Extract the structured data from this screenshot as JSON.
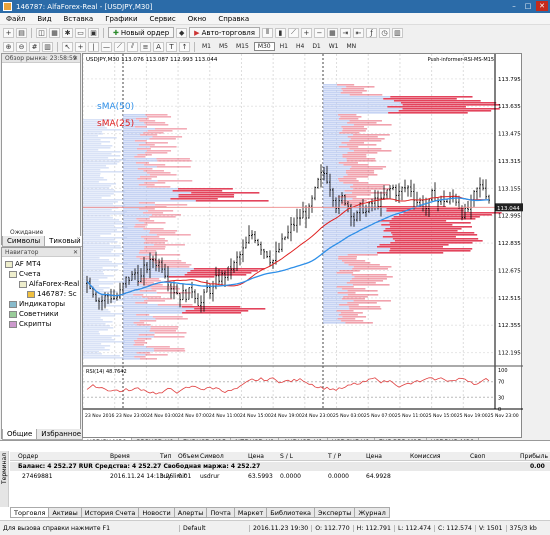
{
  "window": {
    "title": "146787: AlfaForex-Real - [USDJPY,M30]"
  },
  "menu": [
    "Файл",
    "Вид",
    "Вставка",
    "Графики",
    "Сервис",
    "Окно",
    "Справка"
  ],
  "toolbar": {
    "new_order": "Новый ордер",
    "auto_trading": "Авто-торговля",
    "timeframes": [
      "M1",
      "M5",
      "M15",
      "M30",
      "H1",
      "H4",
      "D1",
      "W1",
      "MN"
    ]
  },
  "market_watch": {
    "title": "Обзор рынка: 23:58:59",
    "status": "Ожидание обновления",
    "tabs": [
      "Символы",
      "Тиковый гр"
    ]
  },
  "navigator": {
    "title": "Навигатор",
    "items": [
      "AF MT4",
      "Счета",
      "AlfaForex-Real",
      "146787: Sc",
      "Индикаторы",
      "Советники",
      "Скрипты"
    ],
    "tabs": [
      "Общие",
      "Избранное"
    ]
  },
  "chart": {
    "header": "USDJPY,M30  113.076 113.087 112.993 113.044",
    "indicator_name": "Push-informer-RSI-MS-M15",
    "sma50": "sMA(50)",
    "sma25": "sMA(25)",
    "rsi_label": "RSI(14) 48.7642",
    "price_ticks": [
      "113.795",
      "113.635",
      "113.475",
      "113.315",
      "113.155",
      "112.995",
      "112.835",
      "112.675",
      "112.515",
      "112.355",
      "112.195"
    ],
    "price_hi": 113.87,
    "price_lo": 112.14,
    "current_price": "113.044",
    "rsi_ticks": [
      "100",
      "70",
      "30",
      "0"
    ],
    "time_ticks": [
      "23 Nov 2016",
      "23 Nov 23:00",
      "24 Nov 03:00",
      "24 Nov 07:00",
      "24 Nov 11:00",
      "24 Nov 15:00",
      "24 Nov 19:00",
      "24 Nov 23:00",
      "25 Nov 03:00",
      "25 Nov 07:00",
      "25 Nov 11:00",
      "25 Nov 15:00",
      "25 Nov 19:00",
      "25 Nov 23:00"
    ],
    "colors": {
      "sma50": "#2e8fe8",
      "sma25": "#e02020",
      "volume": "#e0304a",
      "profile": "#b8c8f0"
    }
  },
  "symbol_tabs": [
    "USDJPY,M30",
    "GBPUSD,H1",
    "EURUSD,M15",
    "NZDUSD,H1",
    "AUDUSD,H1",
    "USDCHF,H1",
    "EURGBP,M15",
    "USDRUR,M30"
  ],
  "terminal": {
    "columns": [
      "Ордер",
      "Время",
      "Тип",
      "Объем",
      "Символ",
      "Цена",
      "S / L",
      "T / P",
      "Цена",
      "Комиссия",
      "Своп",
      "Прибыль"
    ],
    "balance": "Баланс: 4 252.27 RUR  Средства: 4 252.27  Свободная маржа: 4 252.27",
    "balance_profit": "0.00",
    "row": [
      "27469881",
      "2016.11.24 14:13:26",
      "buy limit",
      "0.01",
      "usdrur",
      "63.5993",
      "0.0000",
      "0.0000",
      "64.9928",
      "",
      ""
    ],
    "tabs": [
      "Торговля",
      "Активы",
      "История Счета",
      "Новости",
      "Алерты",
      "Почта",
      "Маркет",
      "Библиотека",
      "Эксперты",
      "Журнал"
    ],
    "side_label": "Терминал"
  },
  "status": {
    "hint": "Для вызова справки нажмите F1",
    "profile": "Default",
    "time": "2016.11.23 19:30",
    "o": "O: 112.770",
    "h": "H: 112.791",
    "l": "L: 112.474",
    "c": "C: 112.574",
    "v": "V: 1501",
    "traffic": "375/3 kb"
  }
}
